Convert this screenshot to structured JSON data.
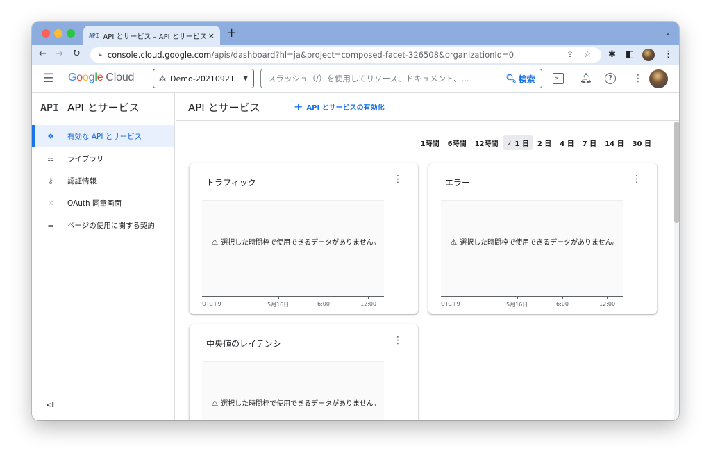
{
  "browser": {
    "tab_favicon": "API",
    "tab_title": "API とサービス – API とサービス",
    "tab_close": "×",
    "new_tab": "+",
    "tab_menu": "⌄",
    "url_host": "console.cloud.google.com",
    "url_path": "/apis/dashboard?hl=ja&project=composed-facet-326508&organizationId=0"
  },
  "header": {
    "brand_google": [
      "G",
      "o",
      "o",
      "g",
      "l",
      "e"
    ],
    "brand_cloud": "Cloud",
    "project_name": "Demo-20210921",
    "search_placeholder": "スラッシュ（/）を使用してリソース、ドキュメント、...",
    "search_button": "検索"
  },
  "sidebar": {
    "title_mark": "API",
    "title": "API とサービス",
    "items": [
      {
        "label": "有効な API とサービス",
        "icon": "diamond-nodes-icon",
        "glyph": "❖",
        "active": true
      },
      {
        "label": "ライブラリ",
        "icon": "library-icon",
        "glyph": "☷",
        "active": false
      },
      {
        "label": "認証情報",
        "icon": "key-icon",
        "glyph": "⚷",
        "active": false
      },
      {
        "label": "OAuth 同意画面",
        "icon": "oauth-consent-icon",
        "glyph": "⁙",
        "active": false
      },
      {
        "label": "ページの使用に関する契約",
        "icon": "page-usage-icon",
        "glyph": "≡",
        "active": false
      }
    ],
    "collapse_label": "<I"
  },
  "main": {
    "page_title": "API とサービス",
    "enable_button": "API とサービスの有効化",
    "time_ranges": [
      {
        "label": "1時間",
        "selected": false
      },
      {
        "label": "6時間",
        "selected": false
      },
      {
        "label": "12時間",
        "selected": false
      },
      {
        "label": "✓ 1 日",
        "selected": true
      },
      {
        "label": "2 日",
        "selected": false
      },
      {
        "label": "4 日",
        "selected": false
      },
      {
        "label": "7 日",
        "selected": false
      },
      {
        "label": "14 日",
        "selected": false
      },
      {
        "label": "30 日",
        "selected": false
      }
    ],
    "cards": [
      {
        "title": "トラフィック",
        "no_data": "選択した時間枠で使用できるデータがありません。",
        "axis": [
          "UTC+9",
          "5月16日",
          "6:00",
          "12:00"
        ]
      },
      {
        "title": "エラー",
        "no_data": "選択した時間枠で使用できるデータがありません。",
        "axis": [
          "UTC+9",
          "5月16日",
          "6:00",
          "12:00"
        ]
      },
      {
        "title": "中央値のレイテンシ",
        "no_data": "選択した時間枠で使用できるデータがありません。",
        "axis": []
      }
    ]
  },
  "colors": {
    "accent": "#1a73e8",
    "tabstrip": "#8cadde",
    "active_nav_bg": "#e8f0fe"
  }
}
